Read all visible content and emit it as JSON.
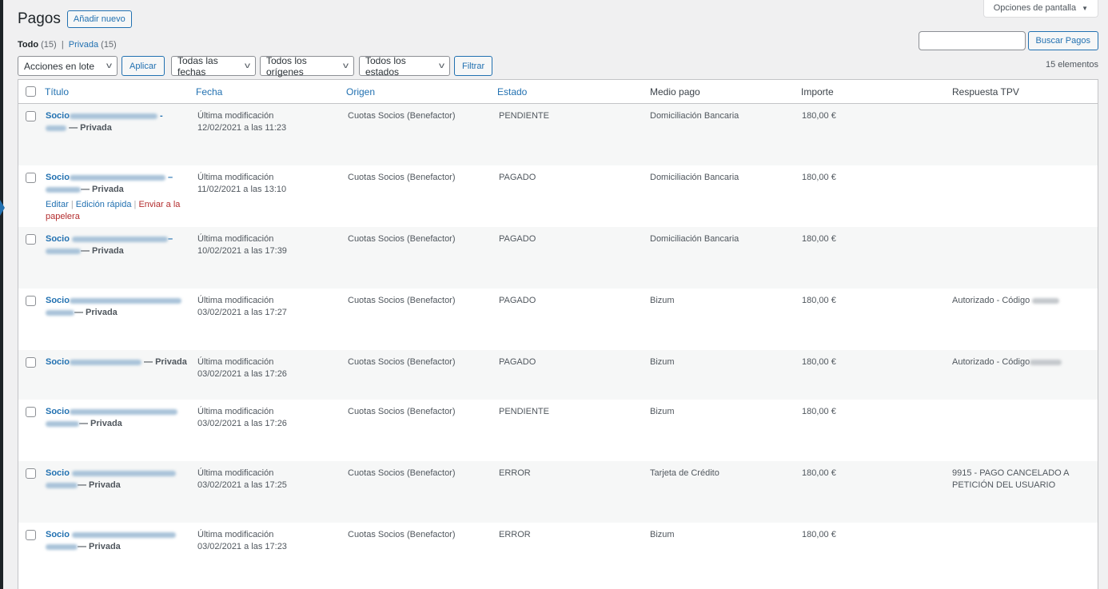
{
  "screen_options": "Opciones de pantalla",
  "page": {
    "title": "Pagos",
    "add_new": "Añadir nuevo"
  },
  "views": {
    "all_label": "Todo",
    "all_count": "(15)",
    "sep": "|",
    "private_label": "Privada",
    "private_count": "(15)"
  },
  "search": {
    "value": "",
    "button": "Buscar Pagos"
  },
  "tablenav": {
    "bulk_actions": "Acciones en lote",
    "apply": "Aplicar",
    "dates": "Todas las fechas",
    "origins": "Todos los orígenes",
    "statuses": "Todos los estados",
    "filter": "Filtrar",
    "items_count": "15 elementos"
  },
  "columns": {
    "title": "Título",
    "date": "Fecha",
    "origin": "Origen",
    "status": "Estado",
    "payment_method": "Medio pago",
    "amount": "Importe",
    "tpv_response": "Respuesta TPV"
  },
  "row_actions": {
    "edit": "Editar",
    "sep": "|",
    "quick_edit": "Edición rápida",
    "trash": "Enviar a la papelera"
  },
  "rows": [
    {
      "title": "Socio",
      "state": "— Privada",
      "date_label": "Última modificación",
      "date": "12/02/2021 a las 11:23",
      "origin": "Cuotas Socios (Benefactor)",
      "status": "PENDIENTE",
      "method": "Domiciliación Bancaria",
      "amount": "180,00 €",
      "tpv": ""
    },
    {
      "title": "Socio",
      "state": "— Privada",
      "date_label": "Última modificación",
      "date": "11/02/2021 a las 13:10",
      "origin": "Cuotas Socios (Benefactor)",
      "status": "PAGADO",
      "method": "Domiciliación Bancaria",
      "amount": "180,00 €",
      "tpv": ""
    },
    {
      "title": "Socio",
      "state": "— Privada",
      "date_label": "Última modificación",
      "date": "10/02/2021 a las 17:39",
      "origin": "Cuotas Socios (Benefactor)",
      "status": "PAGADO",
      "method": "Domiciliación Bancaria",
      "amount": "180,00 €",
      "tpv": ""
    },
    {
      "title": "Socio",
      "state": "— Privada",
      "date_label": "Última modificación",
      "date": "03/02/2021 a las 17:27",
      "origin": "Cuotas Socios (Benefactor)",
      "status": "PAGADO",
      "method": "Bizum",
      "amount": "180,00 €",
      "tpv": "Autorizado - Código"
    },
    {
      "title": "Socio",
      "state": "— Privada",
      "date_label": "Última modificación",
      "date": "03/02/2021 a las 17:26",
      "origin": "Cuotas Socios (Benefactor)",
      "status": "PAGADO",
      "method": "Bizum",
      "amount": "180,00 €",
      "tpv": "Autorizado - Código"
    },
    {
      "title": "Socio",
      "state": "— Privada",
      "date_label": "Última modificación",
      "date": "03/02/2021 a las 17:26",
      "origin": "Cuotas Socios (Benefactor)",
      "status": "PENDIENTE",
      "method": "Bizum",
      "amount": "180,00 €",
      "tpv": ""
    },
    {
      "title": "Socio",
      "state": "— Privada",
      "date_label": "Última modificación",
      "date": "03/02/2021 a las 17:25",
      "origin": "Cuotas Socios (Benefactor)",
      "status": "ERROR",
      "method": "Tarjeta de Crédito",
      "amount": "180,00 €",
      "tpv": "9915 - PAGO CANCELADO A PETICIÓN DEL USUARIO"
    },
    {
      "title": "Socio",
      "state": "— Privada",
      "date_label": "Última modificación",
      "date": "03/02/2021 a las 17:23",
      "origin": "Cuotas Socios (Benefactor)",
      "status": "ERROR",
      "method": "Bizum",
      "amount": "180,00 €",
      "tpv": ""
    }
  ]
}
